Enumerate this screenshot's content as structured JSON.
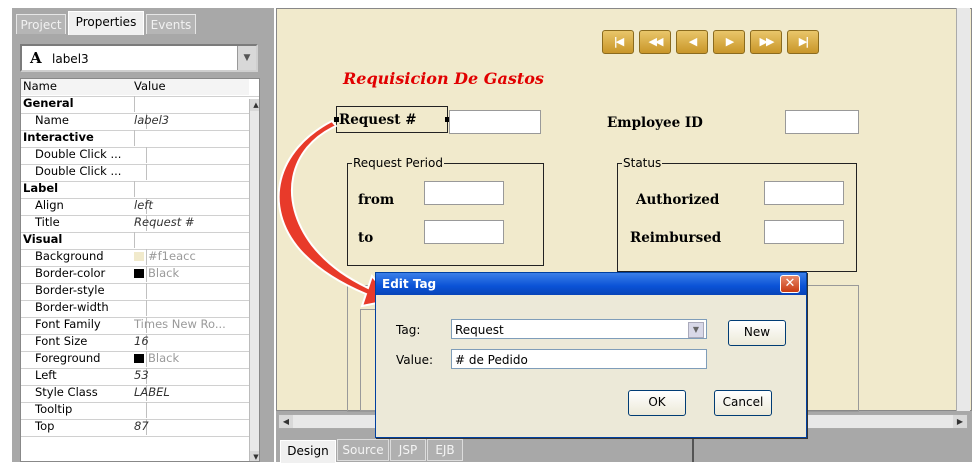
{
  "left_panel": {
    "tabs": [
      {
        "label": "Project",
        "active": false
      },
      {
        "label": "Properties",
        "active": true
      },
      {
        "label": "Events",
        "active": false
      }
    ],
    "component_selector": {
      "icon": "A",
      "value": "label3"
    },
    "grid_headers": {
      "name": "Name",
      "value": "Value"
    },
    "rows": [
      {
        "type": "category",
        "name": "General",
        "value": ""
      },
      {
        "type": "prop",
        "name": "Name",
        "value": "label3"
      },
      {
        "type": "category",
        "name": "Interactive",
        "value": ""
      },
      {
        "type": "prop",
        "name": "Double Click ...",
        "value": ""
      },
      {
        "type": "prop",
        "name": "Double Click ...",
        "value": ""
      },
      {
        "type": "category",
        "name": "Label",
        "value": ""
      },
      {
        "type": "prop",
        "name": "Align",
        "value": "left"
      },
      {
        "type": "prop",
        "name": "Title",
        "value": "Request #"
      },
      {
        "type": "category",
        "name": "Visual",
        "value": ""
      },
      {
        "type": "prop",
        "name": "Background",
        "value": "#f1eacc",
        "swatch": "#f1eacc",
        "gray": true
      },
      {
        "type": "prop",
        "name": "Border-color",
        "value": "Black",
        "swatch": "#000000",
        "gray": true
      },
      {
        "type": "prop",
        "name": "Border-style",
        "value": ""
      },
      {
        "type": "prop",
        "name": "Border-width",
        "value": ""
      },
      {
        "type": "prop",
        "name": "Font Family",
        "value": "Times New Ro...",
        "gray": true
      },
      {
        "type": "prop",
        "name": "Font Size",
        "value": "16"
      },
      {
        "type": "prop",
        "name": "Foreground",
        "value": "Black",
        "swatch": "#000000",
        "gray": true
      },
      {
        "type": "prop",
        "name": "Left",
        "value": "53"
      },
      {
        "type": "prop",
        "name": "Style Class",
        "value": "LABEL"
      },
      {
        "type": "prop",
        "name": "Tooltip",
        "value": ""
      },
      {
        "type": "prop",
        "name": "Top",
        "value": "87"
      }
    ]
  },
  "design": {
    "canvas_bg": "#f1eacc",
    "nav_buttons": [
      {
        "icon": "first-record-icon",
        "glyph": "|◀"
      },
      {
        "icon": "rewind-icon",
        "glyph": "◀◀"
      },
      {
        "icon": "previous-icon",
        "glyph": "◀"
      },
      {
        "icon": "next-icon",
        "glyph": "▶"
      },
      {
        "icon": "fast-forward-icon",
        "glyph": "▶▶"
      },
      {
        "icon": "last-record-icon",
        "glyph": "▶|"
      }
    ],
    "form_title": "Requisicion De Gastos",
    "labels": {
      "request": "Request #",
      "employee_id": "Employee ID",
      "from": "from",
      "to": "to",
      "authorized": "Authorized",
      "reimbursed": "Reimbursed"
    },
    "groups": {
      "request_period": "Request Period",
      "status": "Status"
    },
    "bottom_tabs": [
      {
        "label": "Design",
        "active": true
      },
      {
        "label": "Source",
        "active": false
      },
      {
        "label": "JSP",
        "active": false
      },
      {
        "label": "EJB",
        "active": false
      }
    ]
  },
  "dialog": {
    "title": "Edit Tag",
    "tag_label": "Tag:",
    "tag_value": "Request",
    "value_label": "Value:",
    "value_value": "# de Pedido",
    "new_button": "New",
    "ok_button": "OK",
    "cancel_button": "Cancel"
  },
  "colors": {
    "accent_red": "#e10000",
    "dialog_title": "#0a52d6",
    "arrow": "#e83a2a"
  }
}
